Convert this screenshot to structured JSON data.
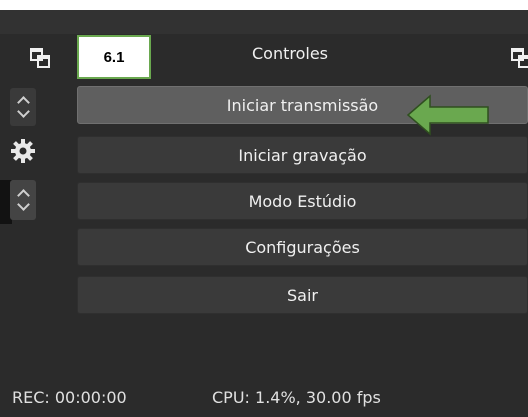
{
  "dock": {
    "title": "Controles",
    "tag": "6.1"
  },
  "buttons": [
    {
      "label": "Iniciar transmissão"
    },
    {
      "label": "Iniciar gravação"
    },
    {
      "label": "Modo Estúdio"
    },
    {
      "label": "Configurações"
    },
    {
      "label": "Sair"
    }
  ],
  "status": {
    "rec": "REC: 00:00:00",
    "cpu": "CPU: 1.4%, 30.00 fps"
  },
  "colors": {
    "background": "#2b2b2b",
    "button": "#3a3a3a",
    "button_active": "#5f5f5f",
    "annotation_arrow": "#6aa84f"
  },
  "icons": [
    "undock-icon",
    "gear-icon",
    "spinner-icon",
    "annotation-arrow-icon"
  ]
}
